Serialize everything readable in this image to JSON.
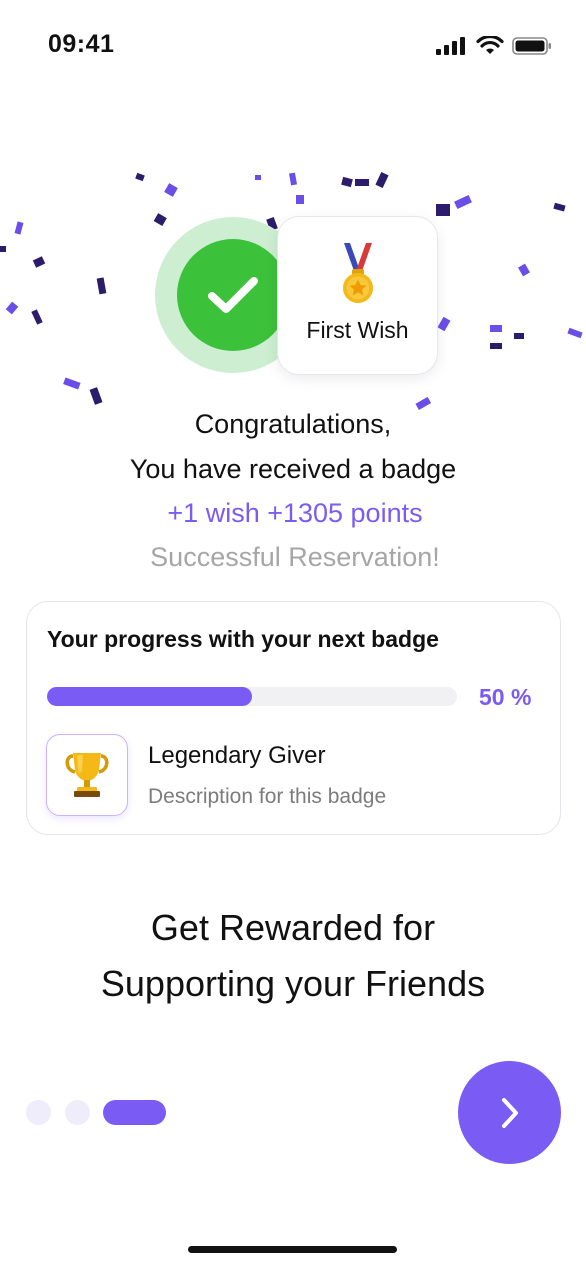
{
  "status_bar": {
    "time": "09:41"
  },
  "badge": {
    "title": "First Wish",
    "icon": "medal-icon"
  },
  "message": {
    "line1": "Congratulations,",
    "line2": "You have received a badge",
    "points": "+1 wish +1305 points",
    "status": "Successful Reservation!"
  },
  "progress": {
    "title": "Your progress with your next badge",
    "percent_label": "50 %",
    "value": 0.5,
    "next_badge_name": "Legendary Giver",
    "next_badge_description": "Description for this badge",
    "next_badge_icon": "trophy-icon"
  },
  "headline": {
    "line1": "Get Rewarded for",
    "line2": "Supporting your Friends"
  },
  "pager": {
    "total": 3,
    "active_index": 2
  },
  "colors": {
    "accent": "#7a5cf5",
    "success": "#3cc13b",
    "muted": "#a6a6a6"
  }
}
